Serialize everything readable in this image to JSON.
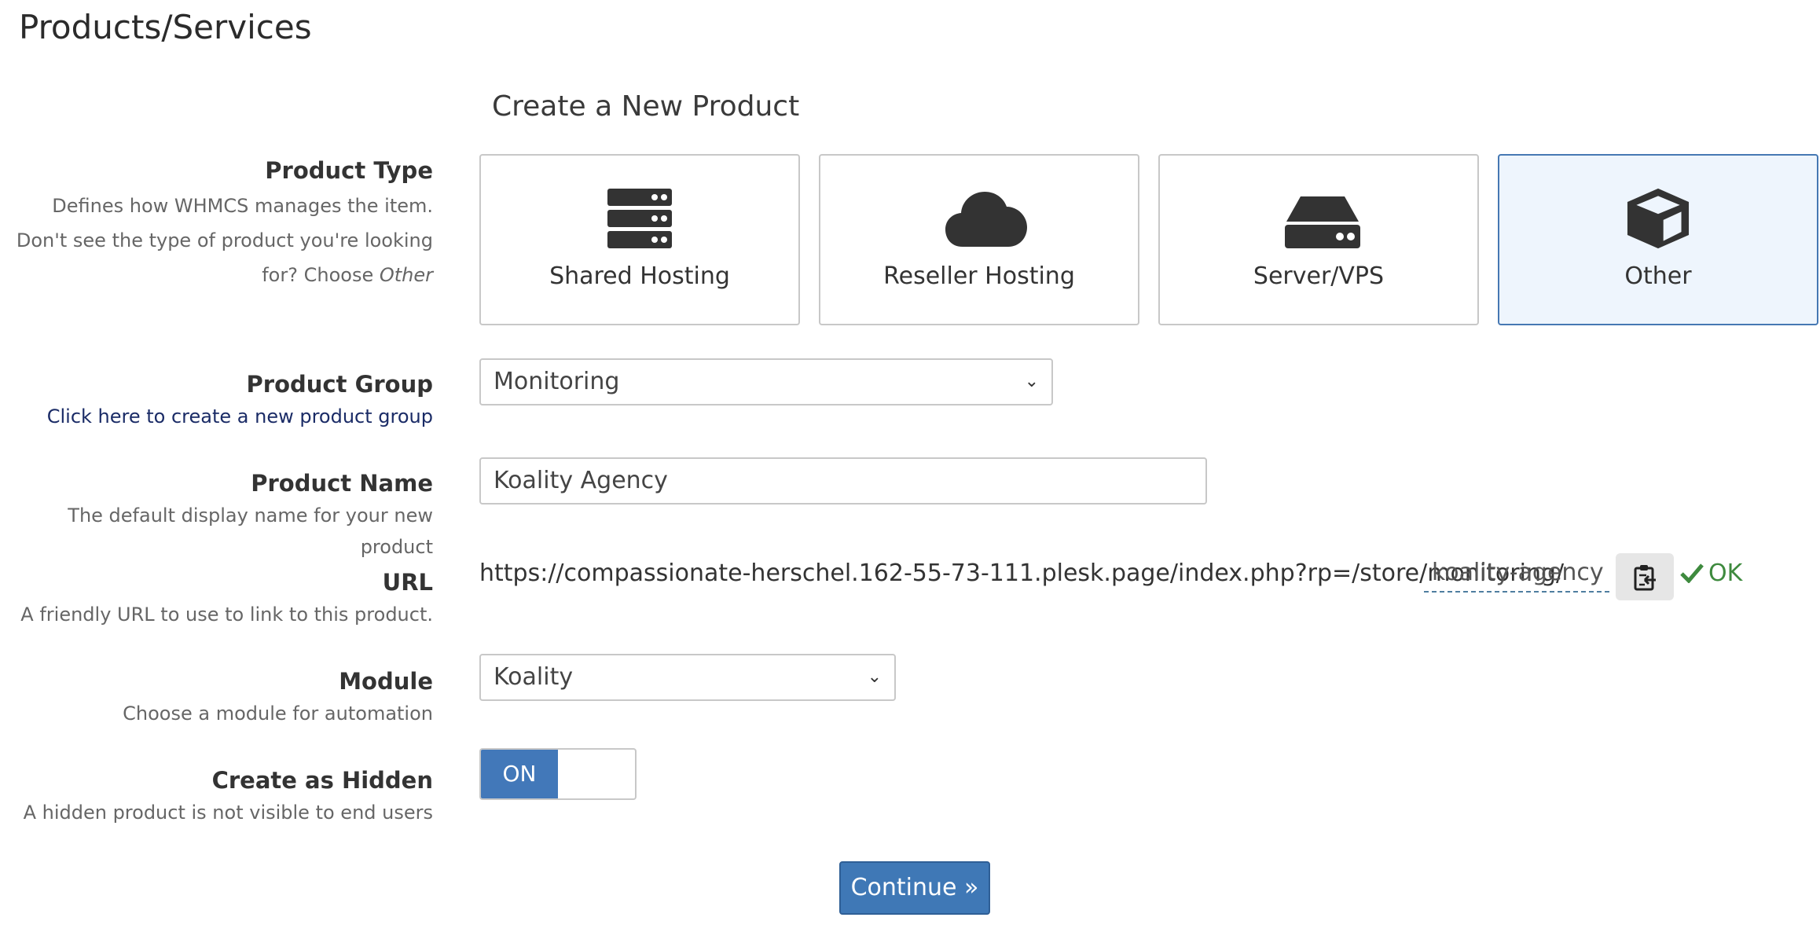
{
  "page": {
    "title": "Products/Services",
    "subtitle": "Create a New Product"
  },
  "product_type": {
    "label": "Product Type",
    "help_line1": "Defines how WHMCS manages the item.",
    "help_line2": "Don't see the type of product you're looking",
    "help_line3_prefix": "for? Choose ",
    "help_line3_em": "Other",
    "options": [
      {
        "name": "Shared Hosting",
        "icon": "server-stack-icon"
      },
      {
        "name": "Reseller Hosting",
        "icon": "cloud-icon"
      },
      {
        "name": "Server/VPS",
        "icon": "hard-drive-icon"
      },
      {
        "name": "Other",
        "icon": "cube-icon",
        "selected": true
      }
    ]
  },
  "product_group": {
    "label": "Product Group",
    "link": "Click here to create a new product group",
    "value": "Monitoring"
  },
  "product_name": {
    "label": "Product Name",
    "help": "The default display name for your new product",
    "value": "Koality Agency"
  },
  "url": {
    "label": "URL",
    "help": "A friendly URL to use to link to this product.",
    "prefix": "https://compassionate-herschel.162-55-73-111.plesk.page/index.php?rp=/store/monitoring/",
    "slug": "koality-agency",
    "status": "OK"
  },
  "module": {
    "label": "Module",
    "help": "Choose a module for automation",
    "value": "Koality"
  },
  "hidden": {
    "label": "Create as Hidden",
    "help": "A hidden product is not visible to end users",
    "toggle_label": "ON"
  },
  "continue_label": "Continue »",
  "colors": {
    "accent": "#4278b9",
    "ok": "#3e8a3e",
    "selected_bg": "#eef5fd"
  }
}
